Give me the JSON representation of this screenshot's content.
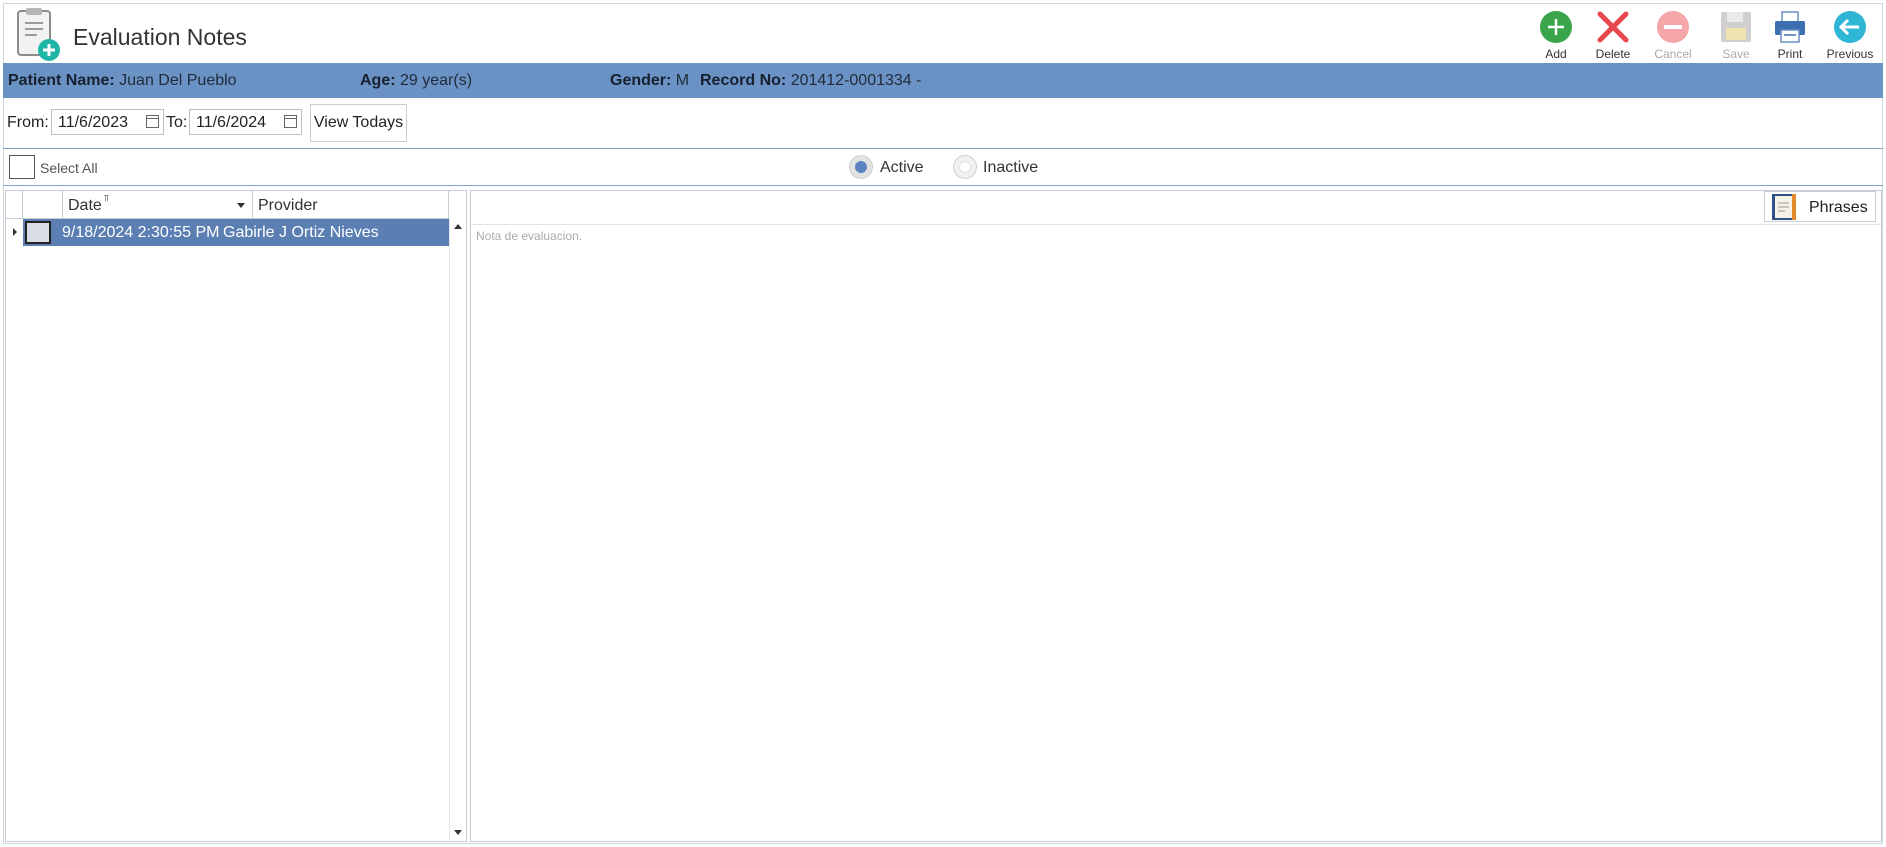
{
  "header": {
    "title": "Evaluation Notes",
    "app_icon": "clipboard-add-icon"
  },
  "toolbar": {
    "add": {
      "label": "Add",
      "icon": "plus-circle-icon",
      "color": "#3aa54a"
    },
    "delete": {
      "label": "Delete",
      "icon": "x-icon",
      "color": "#e8474d"
    },
    "cancel": {
      "label": "Cancel",
      "icon": "minus-circle-icon",
      "color": "#f4a6a9",
      "disabled": true
    },
    "save": {
      "label": "Save",
      "icon": "floppy-disk-icon",
      "disabled": true
    },
    "print": {
      "label": "Print",
      "icon": "printer-icon"
    },
    "previous": {
      "label": "Previous",
      "icon": "arrow-left-circle-icon",
      "color": "#2fb6d4"
    }
  },
  "patient": {
    "name_label": "Patient Name:",
    "name": "Juan Del Pueblo",
    "age_label": "Age:",
    "age": "29 year(s)",
    "gender_label": "Gender:",
    "gender": "M",
    "record_label": "Record No:",
    "record": "201412-0001334 -",
    "bar_color": "#6b92c4"
  },
  "date_filter": {
    "from_label": "From:",
    "from_value": "11/6/2023",
    "to_label": "To:",
    "to_value": "11/6/2024",
    "view_todays": "View Todays"
  },
  "filters": {
    "select_all": "Select All",
    "active": "Active",
    "inactive": "Inactive",
    "selected": "Active"
  },
  "grid": {
    "columns": [
      "Date",
      "Provider"
    ],
    "rows": [
      {
        "date": "9/18/2024 2:30:55 PM",
        "provider": "Gabirle J Ortiz Nieves",
        "selected": true
      }
    ],
    "selection_color": "#5b7fb3"
  },
  "note_panel": {
    "phrases_label": "Phrases",
    "placeholder": "Nota de evaluacion."
  }
}
